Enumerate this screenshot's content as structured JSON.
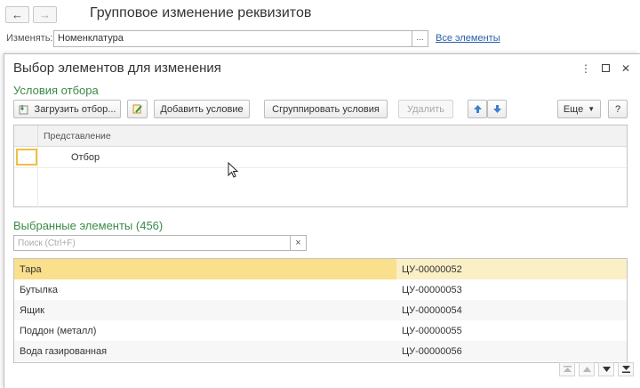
{
  "background_window": {
    "title": "Групповое изменение реквизитов",
    "change_label": "Изменять:",
    "change_value": "Номенклатура",
    "ellipsis": "...",
    "all_elements_link": "Все элементы"
  },
  "dialog": {
    "title": "Выбор элементов для изменения",
    "filter_section": {
      "title": "Условия отбора",
      "buttons": {
        "load_filter": "Загрузить отбор...",
        "add_condition": "Добавить условие",
        "group_conditions": "Сгруппировать условия",
        "delete": "Удалить",
        "more": "Еще",
        "help": "?"
      },
      "table": {
        "column_header": "Представление",
        "rows": [
          {
            "label": "Отбор"
          }
        ]
      }
    },
    "selected_section": {
      "title": "Выбранные элементы (456)",
      "search_placeholder": "Поиск (Ctrl+F)",
      "clear_glyph": "×",
      "rows": [
        {
          "name": "Тара",
          "code": "ЦУ-00000052"
        },
        {
          "name": "Бутылка",
          "code": "ЦУ-00000053"
        },
        {
          "name": "Ящик",
          "code": "ЦУ-00000054"
        },
        {
          "name": "Поддон (металл)",
          "code": "ЦУ-00000055"
        },
        {
          "name": "Вода газированная",
          "code": "ЦУ-00000056"
        }
      ]
    }
  },
  "colors": {
    "section_green": "#3a8b4a",
    "link_blue": "#2a5ea9",
    "selection_yellow": "#fadf8c",
    "arrow_blue": "#3d7fd0"
  },
  "icons": [
    "back-arrow-icon",
    "forward-arrow-icon",
    "kebab-menu-icon",
    "maximize-icon",
    "close-icon",
    "load-filter-icon",
    "settings-edit-icon",
    "move-up-icon",
    "move-down-icon",
    "dropdown-caret-icon",
    "scroll-first-icon",
    "scroll-up-icon",
    "scroll-down-icon",
    "scroll-last-icon"
  ]
}
